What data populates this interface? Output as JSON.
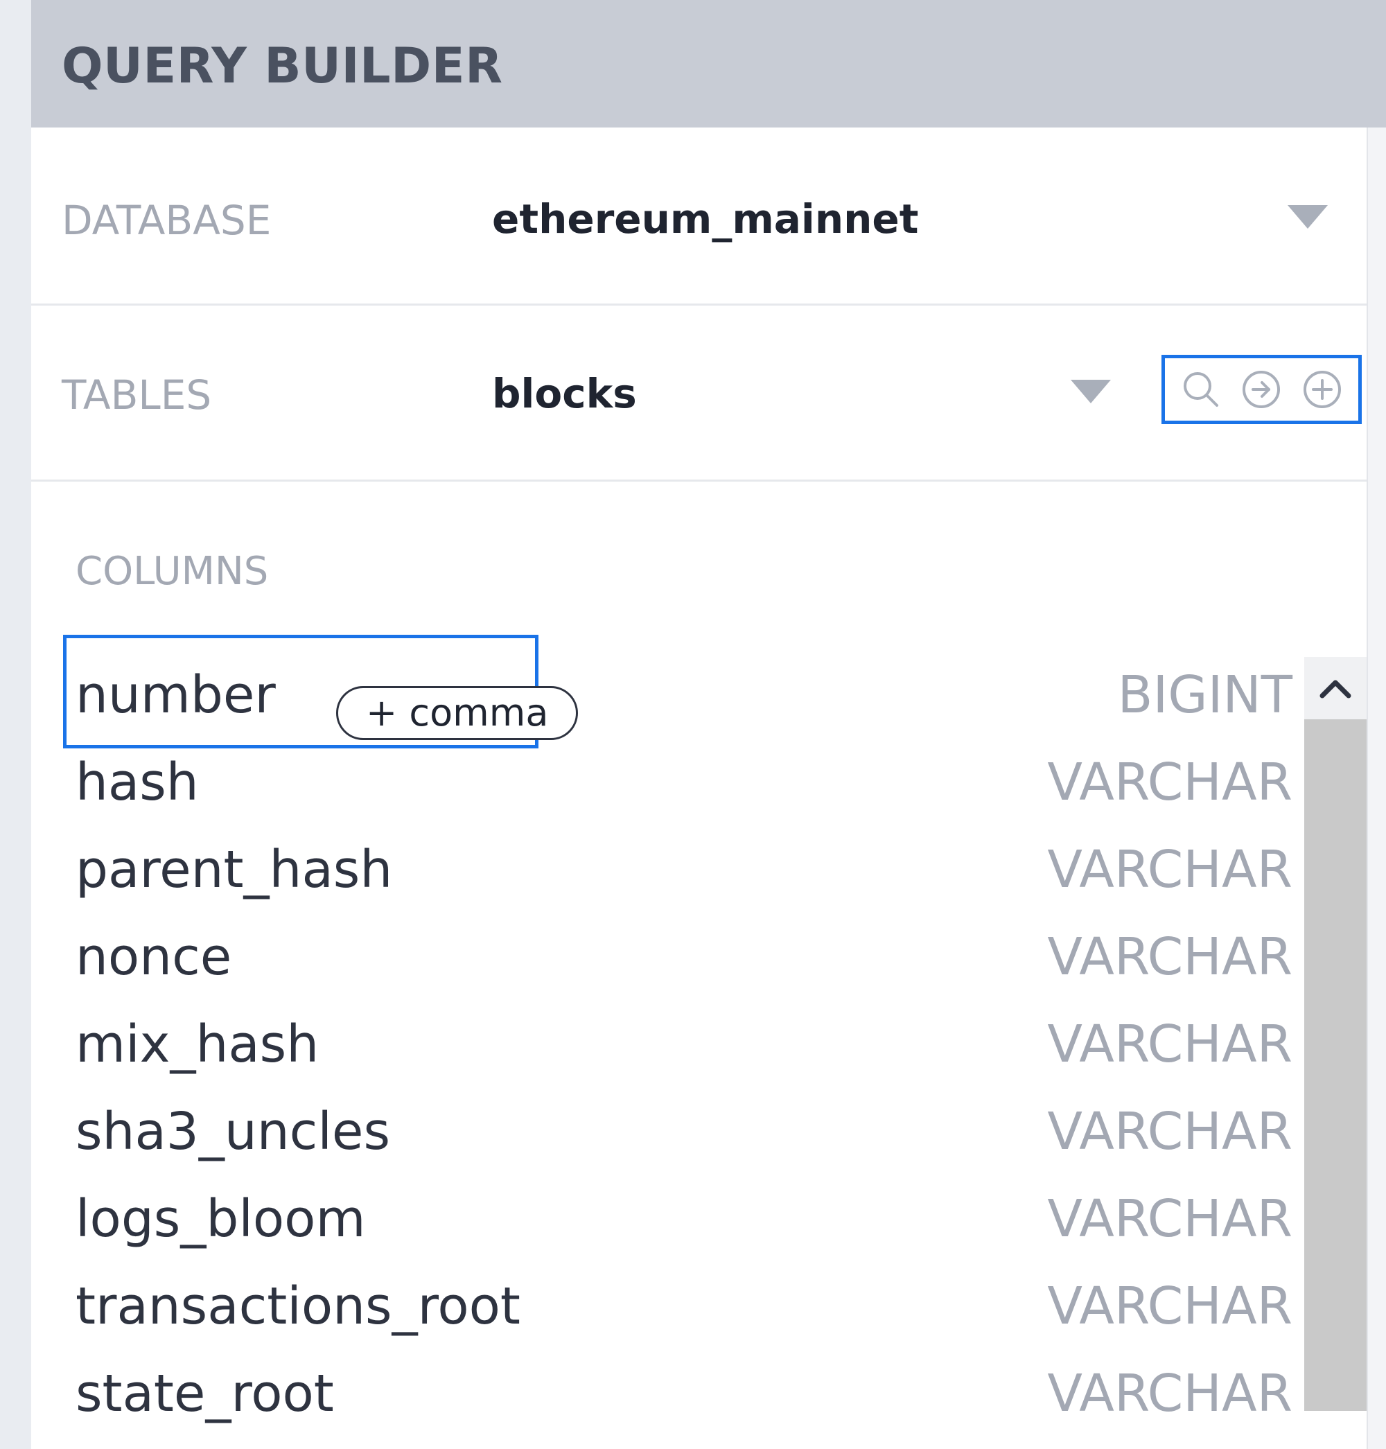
{
  "panel": {
    "title": "QUERY BUILDER"
  },
  "database": {
    "label": "DATABASE",
    "value": "ethereum_mainnet"
  },
  "tables": {
    "label": "TABLES",
    "value": "blocks",
    "tools": [
      "search-icon",
      "arrow-circle-right-icon",
      "plus-circle-icon"
    ]
  },
  "columns": {
    "label": "COLUMNS",
    "comma_button_label": "+ comma",
    "items": [
      {
        "name": "number",
        "type": "BIGINT"
      },
      {
        "name": "hash",
        "type": "VARCHAR"
      },
      {
        "name": "parent_hash",
        "type": "VARCHAR"
      },
      {
        "name": "nonce",
        "type": "VARCHAR"
      },
      {
        "name": "mix_hash",
        "type": "VARCHAR"
      },
      {
        "name": "sha3_uncles",
        "type": "VARCHAR"
      },
      {
        "name": "logs_bloom",
        "type": "VARCHAR"
      },
      {
        "name": "transactions_root",
        "type": "VARCHAR"
      },
      {
        "name": "state_root",
        "type": "VARCHAR"
      }
    ]
  },
  "colors": {
    "accent": "#1a73e8",
    "header_bg": "#c8ccd5",
    "label_gray": "#a3a8b3",
    "text_dark": "#1f2430"
  }
}
